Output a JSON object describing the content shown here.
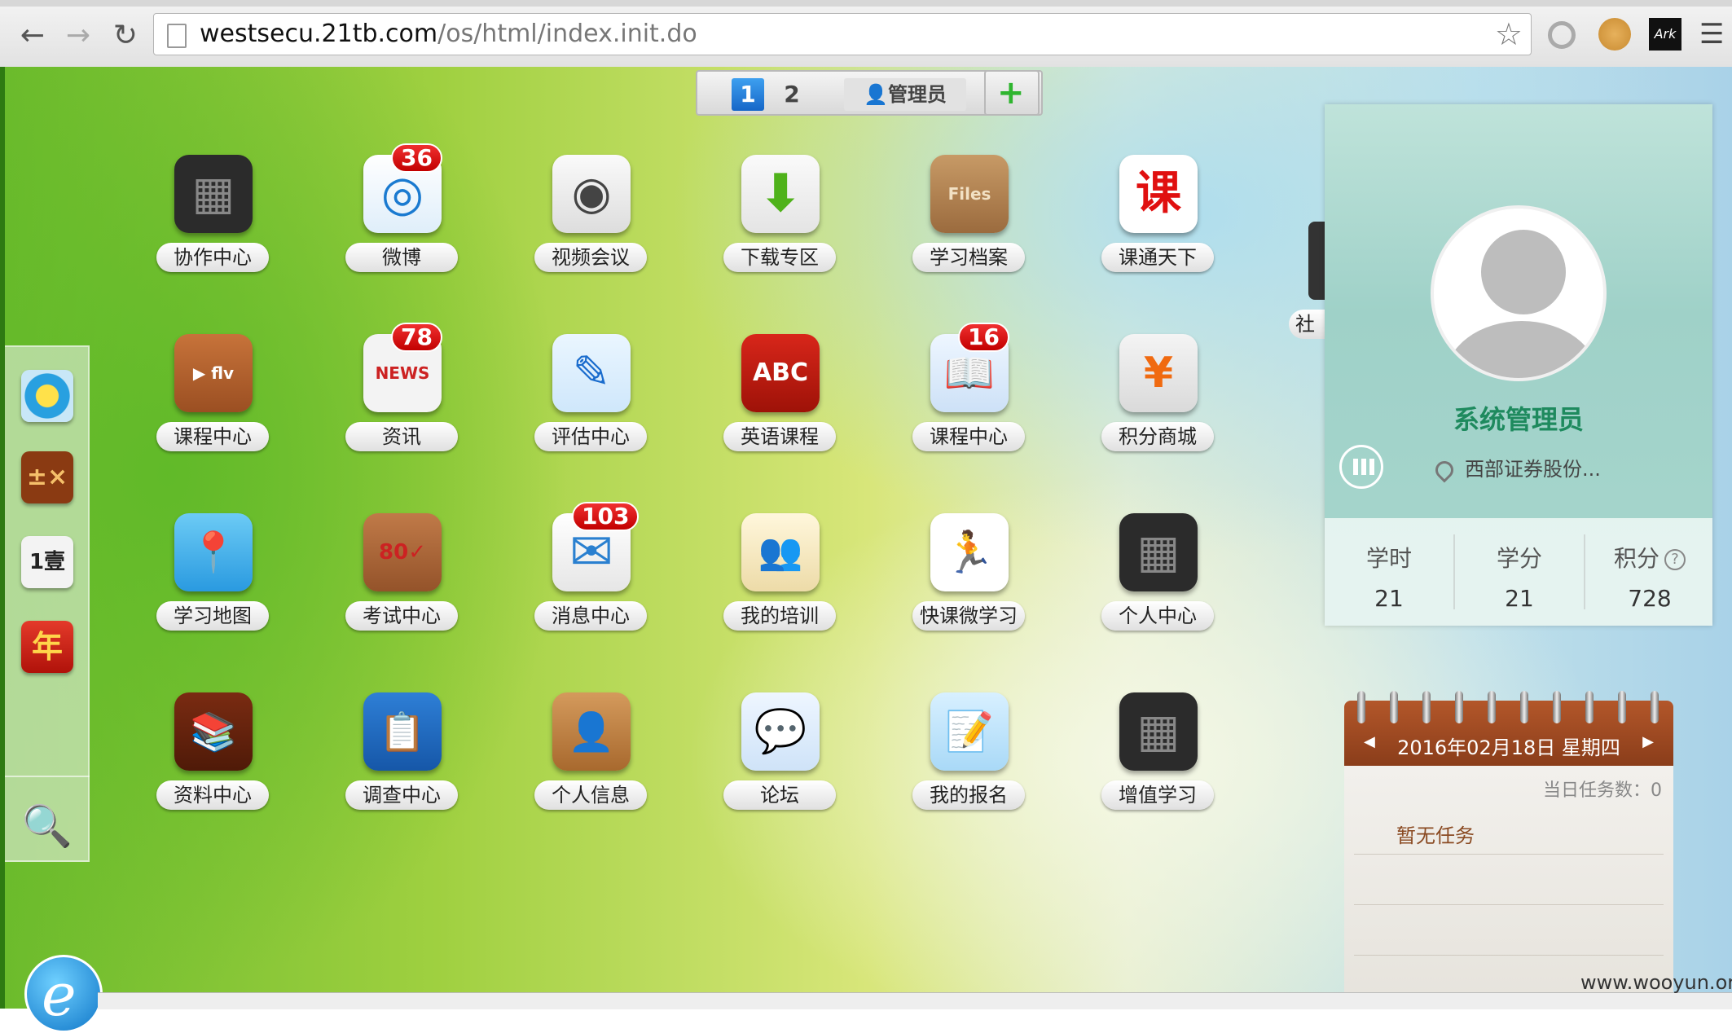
{
  "browser": {
    "url_host": "westsecu.21tb.com",
    "url_path": "/os/html/index.init.do"
  },
  "page_tabs": {
    "tab1": "1",
    "tab2": "2",
    "admin": "管理员",
    "add": "+"
  },
  "apps": [
    {
      "label": "协作中心",
      "icon": "collaboration-icon",
      "badge": ""
    },
    {
      "label": "微博",
      "icon": "weibo-icon",
      "badge": "36"
    },
    {
      "label": "视频会议",
      "icon": "webcam-icon",
      "badge": ""
    },
    {
      "label": "下载专区",
      "icon": "download-icon",
      "badge": ""
    },
    {
      "label": "学习档案",
      "icon": "files-icon",
      "badge": ""
    },
    {
      "label": "课通天下",
      "icon": "ke-logo-icon",
      "badge": ""
    },
    {
      "label": "课程中心",
      "icon": "media-grid-icon",
      "badge": ""
    },
    {
      "label": "资讯",
      "icon": "newspaper-icon",
      "badge": "78"
    },
    {
      "label": "评估中心",
      "icon": "edit-icon",
      "badge": ""
    },
    {
      "label": "英语课程",
      "icon": "abc-book-icon",
      "badge": ""
    },
    {
      "label": "课程中心",
      "icon": "open-book-icon",
      "badge": "16"
    },
    {
      "label": "积分商城",
      "icon": "yen-coin-icon",
      "badge": ""
    },
    {
      "label": "学习地图",
      "icon": "map-pin-icon",
      "badge": ""
    },
    {
      "label": "考试中心",
      "icon": "exam-paper-icon",
      "badge": ""
    },
    {
      "label": "消息中心",
      "icon": "envelope-icon",
      "badge": "103"
    },
    {
      "label": "我的培训",
      "icon": "training-group-icon",
      "badge": ""
    },
    {
      "label": "快课微学习",
      "icon": "runner-icon",
      "badge": ""
    },
    {
      "label": "个人中心",
      "icon": "folder-window-icon",
      "badge": ""
    },
    {
      "label": "资料中心",
      "icon": "bookshelf-icon",
      "badge": ""
    },
    {
      "label": "调查中心",
      "icon": "clipboard-icon",
      "badge": ""
    },
    {
      "label": "个人信息",
      "icon": "address-book-icon",
      "badge": ""
    },
    {
      "label": "论坛",
      "icon": "chat-bubble-icon",
      "badge": ""
    },
    {
      "label": "我的报名",
      "icon": "signup-form-icon",
      "badge": ""
    },
    {
      "label": "增值学习",
      "icon": "folder-window-icon",
      "badge": ""
    }
  ],
  "partial_app_label": "社",
  "dock": {
    "items": [
      "skype-like-icon",
      "calculator-icon",
      "calendar-money-icon",
      "new-year-icon"
    ],
    "kc1": "1壹",
    "kc2": "年",
    "search": "search-icon"
  },
  "profile": {
    "name": "系统管理员",
    "org": "西部证券股份...",
    "stats": [
      {
        "label": "学时",
        "value": "21"
      },
      {
        "label": "学分",
        "value": "21"
      },
      {
        "label": "积分",
        "value": "728"
      }
    ],
    "help": "?"
  },
  "calendar": {
    "date": "2016年02月18日 星期四",
    "task_count": "当日任务数：0",
    "no_task": "暂无任务"
  },
  "watermark": "www.wooyun.org",
  "colors": {
    "badge": "#d61616",
    "accent_tab": "#1a74d6",
    "profile_name": "#1e8a5e"
  }
}
